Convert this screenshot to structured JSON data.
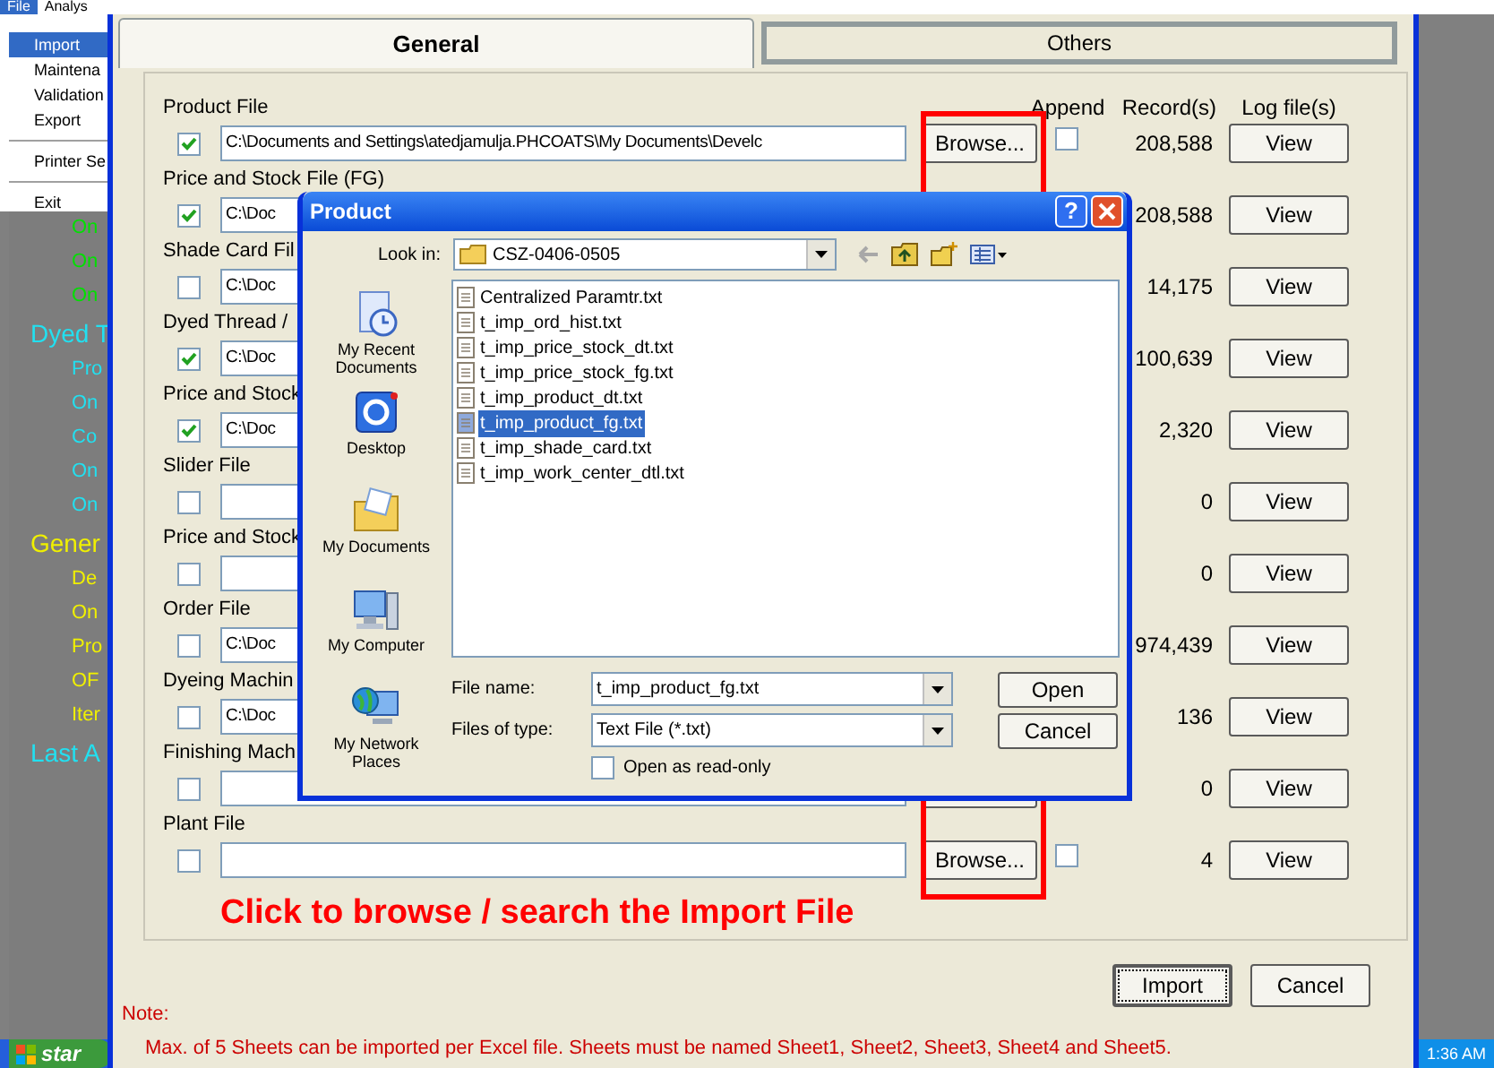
{
  "background_app": {
    "menu_bar": [
      {
        "label": "File",
        "selected": true
      },
      {
        "label": "Analys",
        "selected": false
      }
    ],
    "menu": [
      {
        "label": "Import",
        "selected": true,
        "separator_before": false
      },
      {
        "label": "Maintena",
        "selected": false,
        "separator_before": false
      },
      {
        "label": "Validation",
        "selected": false,
        "separator_before": false
      },
      {
        "label": "Export",
        "selected": false,
        "separator_before": false
      },
      {
        "label": "Printer Se",
        "selected": false,
        "separator_before": true
      },
      {
        "label": "Exit",
        "selected": false,
        "separator_before": true
      }
    ],
    "panel_items": [
      {
        "text": "On",
        "kind": "item",
        "color": "#00e000"
      },
      {
        "text": "On",
        "kind": "item",
        "color": "#00e000"
      },
      {
        "text": "On",
        "kind": "item",
        "color": "#00e000"
      },
      {
        "text": "Dyed T",
        "kind": "heading",
        "color": "#22e0f0"
      },
      {
        "text": "Pro",
        "kind": "item",
        "color": "#22e0f0"
      },
      {
        "text": "On",
        "kind": "item",
        "color": "#22e0f0"
      },
      {
        "text": "Co",
        "kind": "item",
        "color": "#22e0f0"
      },
      {
        "text": "On",
        "kind": "item",
        "color": "#22e0f0"
      },
      {
        "text": "On",
        "kind": "item",
        "color": "#22e0f0"
      },
      {
        "text": "Gener",
        "kind": "heading",
        "color": "#f0f000"
      },
      {
        "text": "De",
        "kind": "item",
        "color": "#f0f000"
      },
      {
        "text": "On",
        "kind": "item",
        "color": "#f0f000"
      },
      {
        "text": "Pro",
        "kind": "item",
        "color": "#f0f000"
      },
      {
        "text": "OF",
        "kind": "item",
        "color": "#f0f000"
      },
      {
        "text": "Iter",
        "kind": "item",
        "color": "#f0f000"
      },
      {
        "text": "Last A",
        "kind": "heading",
        "color": "#22e0f0"
      }
    ]
  },
  "import_dialog": {
    "tabs": [
      {
        "label": "General",
        "selected": true,
        "highlighted": false
      },
      {
        "label": "Others",
        "selected": false,
        "highlighted": true
      }
    ],
    "columns": [
      "Append",
      "Record(s)",
      "Log file(s)"
    ],
    "rows": [
      {
        "label": "Product File",
        "checked": true,
        "path": "C:\\Documents and Settings\\atedjamulja.PHCOATS\\My Documents\\Develc",
        "browse": "Browse...",
        "append_checked": false,
        "records": "208,588",
        "view": "View"
      },
      {
        "label": "Price and Stock File (FG)",
        "checked": true,
        "path": "C:\\Doc",
        "records": "208,588",
        "view": "View"
      },
      {
        "label": "Shade Card Fil",
        "checked": false,
        "path": "C:\\Doc",
        "records": "14,175",
        "view": "View"
      },
      {
        "label": "Dyed Thread /",
        "checked": true,
        "path": "C:\\Doc",
        "records": "100,639",
        "view": "View"
      },
      {
        "label": "Price and Stock",
        "checked": true,
        "path": "C:\\Doc",
        "records": "2,320",
        "view": "View"
      },
      {
        "label": "Slider File",
        "checked": false,
        "records": "0",
        "view": "View"
      },
      {
        "label": "Price and Stock",
        "checked": false,
        "records": "0",
        "view": "View"
      },
      {
        "label": "Order File",
        "checked": false,
        "path": "C:\\Doc",
        "records": "974,439",
        "view": "View"
      },
      {
        "label": "Dyeing Machin",
        "checked": false,
        "path": "C:\\Doc",
        "records": "136",
        "view": "View"
      },
      {
        "label": "Finishing Mach",
        "checked": false,
        "records": "0",
        "view": "View"
      },
      {
        "label": "Plant File",
        "checked": false,
        "browse": "Browse...",
        "append_checked": false,
        "records": "4",
        "view": "View"
      }
    ],
    "hint": "Click to browse / search the Import File",
    "buttons": [
      {
        "label": "Import",
        "focused": true
      },
      {
        "label": "Cancel",
        "focused": false
      }
    ],
    "note_title": "Note:",
    "note": "Max. of 5 Sheets can be imported per Excel file. Sheets must be named Sheet1, Sheet2, Sheet3, Sheet4 and Sheet5."
  },
  "file_dialog": {
    "title": "Product",
    "help": "?",
    "look_in_label": "Look in:",
    "look_in": "CSZ-0406-0505",
    "places": [
      {
        "label": "My Recent Documents",
        "kind": "recent"
      },
      {
        "label": "Desktop",
        "kind": "desktop"
      },
      {
        "label": "My Documents",
        "kind": "documents"
      },
      {
        "label": "My Computer",
        "kind": "computer"
      },
      {
        "label": "My Network Places",
        "kind": "network"
      }
    ],
    "files": [
      {
        "name": "Centralized Paramtr.txt",
        "selected": false
      },
      {
        "name": "t_imp_ord_hist.txt",
        "selected": false
      },
      {
        "name": "t_imp_price_stock_dt.txt",
        "selected": false
      },
      {
        "name": "t_imp_price_stock_fg.txt",
        "selected": false
      },
      {
        "name": "t_imp_product_dt.txt",
        "selected": false
      },
      {
        "name": "t_imp_product_fg.txt",
        "selected": true
      },
      {
        "name": "t_imp_shade_card.txt",
        "selected": false
      },
      {
        "name": "t_imp_work_center_dtl.txt",
        "selected": false
      }
    ],
    "file_name_label": "File name:",
    "file_name": "t_imp_product_fg.txt",
    "file_type_label": "Files of type:",
    "file_type": "Text File (*.txt)",
    "read_only_label": "Open as read-only",
    "read_only": false,
    "open_button": "Open",
    "cancel_button": "Cancel"
  },
  "taskbar": {
    "start": "star",
    "clock": "1:36 AM"
  }
}
